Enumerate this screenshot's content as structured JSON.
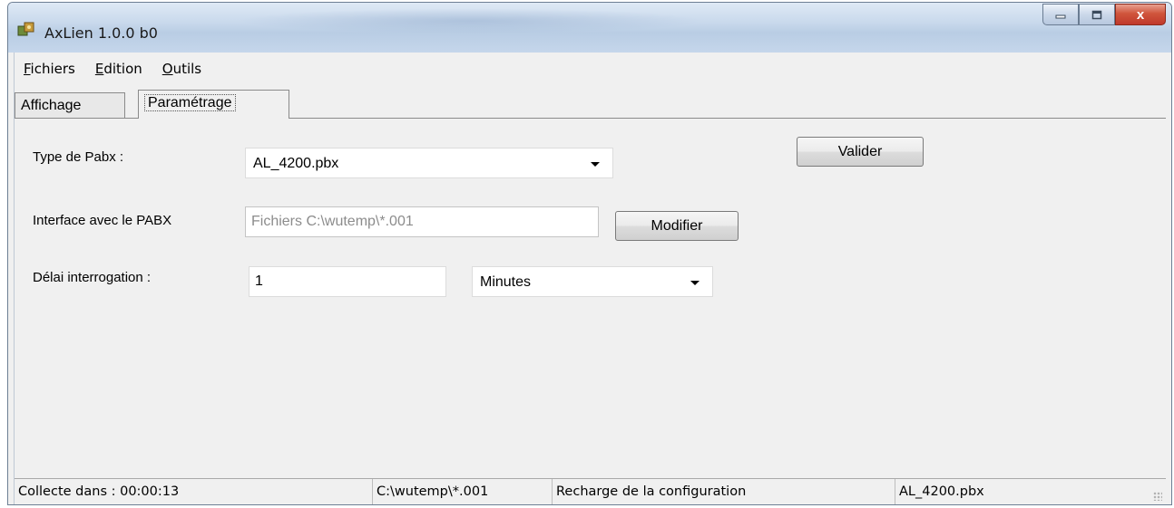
{
  "window": {
    "title": "AxLien 1.0.0  b0",
    "caption_buttons": {
      "minimize_icon": "minimize-icon",
      "maximize_icon": "maximize-icon",
      "close_icon": "close-icon",
      "close_glyph": "x"
    }
  },
  "menu": {
    "items": [
      {
        "underline": "F",
        "rest": "ichiers"
      },
      {
        "underline": "E",
        "rest": "dition"
      },
      {
        "underline": "O",
        "rest": "utils"
      }
    ]
  },
  "tabs": [
    {
      "label": "Affichage",
      "active": false
    },
    {
      "label": "Paramétrage",
      "active": true
    }
  ],
  "form": {
    "pabx_type_label": "Type de Pabx :",
    "pabx_type_value": "AL_4200.pbx",
    "validate_button": "Valider",
    "interface_label": "Interface avec le PABX",
    "interface_value": "Fichiers C:\\wutemp\\*.001",
    "modify_button": "Modifier",
    "delay_label": "Délai interrogation :",
    "delay_value": "1",
    "delay_unit": "Minutes"
  },
  "statusbar": {
    "collect": "Collecte dans : 00:00:13",
    "path": "C:\\wutemp\\*.001",
    "message": "Recharge de la configuration",
    "pbx": "AL_4200.pbx"
  },
  "colors": {
    "titlebar": "#c9d9ec",
    "close_button": "#c0392b",
    "client_bg": "#f0f0f0"
  }
}
